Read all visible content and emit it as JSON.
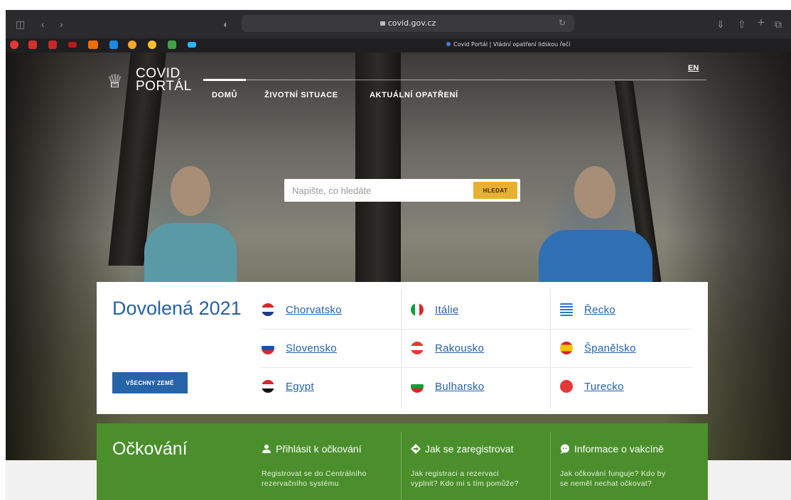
{
  "browser": {
    "url": "covid.gov.cz",
    "tab_title": "Covid Portál | Vládní opatření lidskou řečí"
  },
  "header": {
    "logo_line1": "COVID",
    "logo_line2": "PORTÁL",
    "nav": [
      "DOMŮ",
      "ŽIVOTNÍ SITUACE",
      "AKTUÁLNÍ OPATŘENÍ"
    ],
    "lang": "EN"
  },
  "search": {
    "placeholder": "Napište, co hledáte",
    "button": "HLEDAT"
  },
  "vacation": {
    "title_word": "Dovolená",
    "title_year": "2021",
    "all_button": "VŠECHNY ZEMĚ",
    "countries": [
      {
        "name": "Chorvatsko"
      },
      {
        "name": "Itálie"
      },
      {
        "name": "Řecko"
      },
      {
        "name": "Slovensko"
      },
      {
        "name": "Rakousko"
      },
      {
        "name": "Španělsko"
      },
      {
        "name": "Egypt"
      },
      {
        "name": "Bulharsko"
      },
      {
        "name": "Turecko"
      }
    ]
  },
  "vaccination": {
    "title": "Očkování",
    "items": [
      {
        "heading": "Přihlásit k očkování",
        "text_line1": "Registrovat se do Centrálního",
        "text_line2": "rezervačního systému",
        "icon": "person-icon"
      },
      {
        "heading": "Jak se zaregistrovat",
        "text_line1": "Jak registraci a rezervaci",
        "text_line2": "vyplnit? Kdo mi s tím pomůže?",
        "icon": "diamond-arrow-icon"
      },
      {
        "heading": "Informace o vakcíně",
        "text_line1": "Jak očkování funguje? Kdo by",
        "text_line2": "se neměl nechat očkovat?",
        "icon": "chat-icon"
      }
    ]
  },
  "colors": {
    "primary_blue": "#2661a6",
    "vaccination_green": "#4a8f2b",
    "search_button": "#e8b030"
  }
}
